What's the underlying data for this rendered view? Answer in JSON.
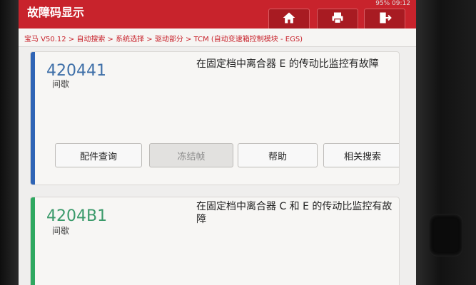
{
  "header": {
    "title": "故障码显示",
    "status": "95% 09:12",
    "home_icon": "home-icon",
    "print_icon": "print-icon",
    "exit_icon": "exit-icon"
  },
  "breadcrumb": "宝马 V50.12 > 自动搜索 > 系统选择 > 驱动部分 > TCM (自动变速箱控制模块 - EGS)",
  "dtcs": [
    {
      "code": "420441",
      "status": "间歇",
      "description": "在固定档中离合器 E 的传动比监控有故障",
      "stripe_color": "#2f64b5",
      "buttons": [
        "配件查询",
        "冻结帧",
        "帮助",
        "相关搜索"
      ]
    },
    {
      "code": "4204B1",
      "status": "间歇",
      "description": "在固定档中离合器 C 和 E 的传动比监控有故障",
      "stripe_color": "#2fa860"
    }
  ],
  "colors": {
    "header": "#c8232c",
    "accent": "#3e6fa8"
  }
}
